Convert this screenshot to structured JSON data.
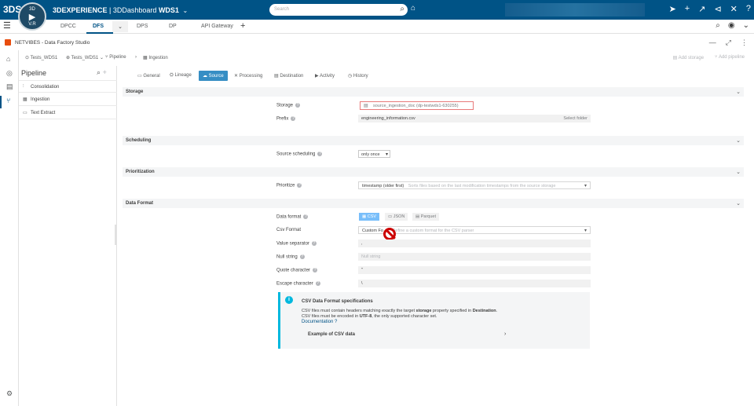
{
  "topbar": {
    "logo": "3DS",
    "compass_user": "V.R",
    "compass_top": "3D",
    "brand": "3DEXPERIENCE",
    "dashboard": "| 3DDashboard",
    "dashboard_name": "WDS1",
    "search_placeholder": "Search"
  },
  "tabs": [
    {
      "label": "DPCC"
    },
    {
      "label": "DFS"
    },
    {
      "label": "DPS"
    },
    {
      "label": "DP"
    },
    {
      "label": "API Gateway"
    }
  ],
  "app": {
    "title": "NETVIBES - Data Factory Studio"
  },
  "breadcrumb": {
    "items": [
      "Tests_WDS1",
      "Tests_WDS1",
      "Pipeline",
      "Ingestion"
    ],
    "add_storage": "Add storage",
    "add_pipeline": "Add pipeline"
  },
  "pipeline": {
    "title": "Pipeline",
    "items": [
      {
        "label": "Consolidation"
      },
      {
        "label": "Ingestion"
      },
      {
        "label": "Text Extract"
      }
    ]
  },
  "function_tabs": [
    "General",
    "Lineage",
    "Source",
    "Processing",
    "Destination",
    "Activity",
    "History"
  ],
  "sections": {
    "storage": "Storage",
    "scheduling": "Scheduling",
    "prioritization": "Prioritization",
    "data_format": "Data Format"
  },
  "fields": {
    "storage_label": "Storage",
    "storage_value": "source_ingestion_doc (dp-testwds1-630255)",
    "prefix_label": "Prefix",
    "prefix_value": "engineering_information.csv",
    "prefix_btn": "Select folder",
    "source_sched_label": "Source scheduling",
    "source_sched_value": "only once",
    "prioritize_label": "Prioritize",
    "prioritize_value": "timestamp (older first)",
    "prioritize_hint": "Sorts files based on the last modification timestamps from the source storage",
    "data_format_label": "Data format",
    "formats": [
      "CSV",
      "JSON",
      "Parquet"
    ],
    "csv_format_label": "Csv Format",
    "csv_format_value": "Custom Fo",
    "csv_format_hint": "Define a custom format for the CSV parser",
    "value_sep_label": "Value separator",
    "value_sep_value": ",",
    "null_string_label": "Null string",
    "null_string_placeholder": "Null string",
    "quote_label": "Quote character",
    "quote_value": "\"",
    "escape_label": "Escape character",
    "escape_value": "\\"
  },
  "info": {
    "title": "CSV Data Format specifications",
    "line1_a": "CSV files must contain headers matching exactly the target ",
    "line1_b": "storage",
    "line1_c": " property specified in ",
    "line1_d": "Destination",
    "line1_e": ".",
    "line2_a": "CSV files must be encoded in ",
    "line2_b": "UTF-8",
    "line2_c": ", the only supported character set.",
    "link": "Documentation",
    "example": "Example of CSV data"
  },
  "colors": {
    "topbar": "#005386",
    "accent": "#368ec4",
    "error_border": "#e87a7a",
    "info": "#00b8de"
  }
}
